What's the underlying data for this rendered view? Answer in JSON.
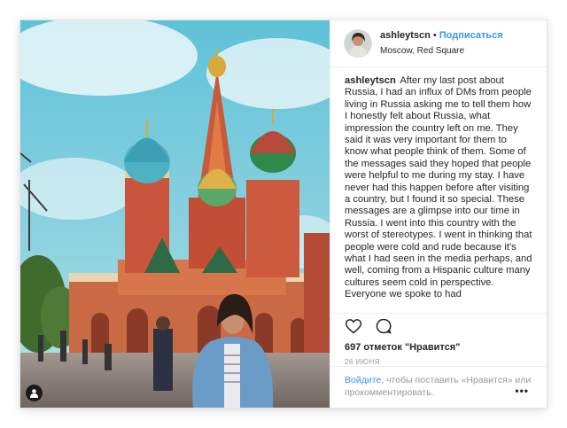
{
  "post": {
    "username": "ashleytscn",
    "follow_label": "Подписаться",
    "location": "Moscow, Red Square",
    "caption": "After my last post about Russia, I had an influx of DMs from people living in Russia asking me to tell them how I honestly felt about Russia, what impression the country left on me. They said it was very important for them to know what people think of them. Some of the messages said they hoped that people were helpful to me during my stay. I have never had this happen before after visiting a country, but I found it so special. These messages are a glimpse into our time in Russia. I went into this country with the worst of stereotypes. I went in thinking that people were cold and rude because it's what I had seen in the media perhaps, and well, coming from a Hispanic culture many cultures seem cold in perspective. Everyone we spoke to had",
    "likes": "697 отметок \"Нравится\"",
    "date": "26 июня",
    "login_link": "Войдите",
    "login_text": ", чтобы поставить «Нравится» или прокомментировать.",
    "more_label": "•••"
  },
  "icons": {
    "like": "heart-icon",
    "comment": "comment-icon",
    "user_tag": "user-tag-icon",
    "more": "more-options-icon"
  },
  "colors": {
    "accent": "#3897f0",
    "text": "#262626",
    "muted": "#999999",
    "border": "#efefef"
  }
}
